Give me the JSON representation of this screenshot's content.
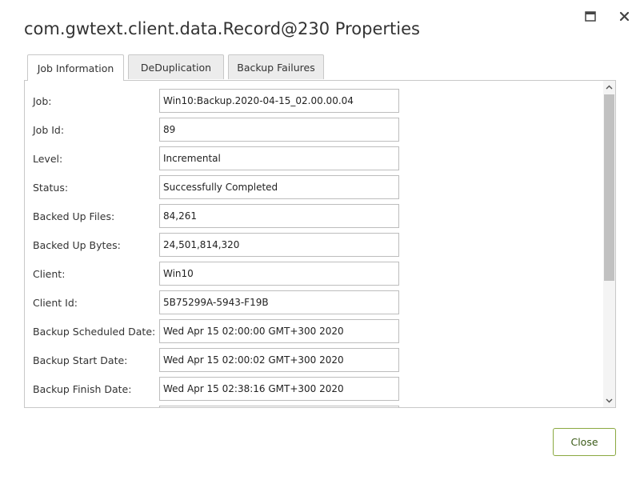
{
  "dialog": {
    "title": "com.gwtext.client.data.Record@230 Properties",
    "tabs": [
      "Job Information",
      "DeDuplication",
      "Backup Failures"
    ],
    "active_tab": "Job Information",
    "close_button": "Close"
  },
  "fields": [
    {
      "label": "Job:",
      "value": "Win10:Backup.2020-04-15_02.00.00.04"
    },
    {
      "label": "Job Id:",
      "value": "89"
    },
    {
      "label": "Level:",
      "value": "Incremental"
    },
    {
      "label": "Status:",
      "value": "Successfully Completed"
    },
    {
      "label": "Backed Up Files:",
      "value": "84,261"
    },
    {
      "label": "Backed Up Bytes:",
      "value": "24,501,814,320"
    },
    {
      "label": "Client:",
      "value": "Win10"
    },
    {
      "label": "Client Id:",
      "value": "5B75299A-5943-F19B"
    },
    {
      "label": "Backup Scheduled Date:",
      "value": "Wed Apr 15 02:00:00 GMT+300 2020"
    },
    {
      "label": "Backup Start Date:",
      "value": "Wed Apr 15 02:00:02 GMT+300 2020"
    },
    {
      "label": "Backup Finish Date:",
      "value": "Wed Apr 15 02:38:16 GMT+300 2020"
    }
  ],
  "colors": {
    "close_button_border": "#8aa840",
    "close_button_text": "#3a5a17",
    "scroll_thumb": "#c1c1c1"
  },
  "icons": {
    "maximize": "maximize-icon",
    "close": "close-icon",
    "scroll_up": "chevron-up-icon",
    "scroll_down": "chevron-down-icon"
  }
}
